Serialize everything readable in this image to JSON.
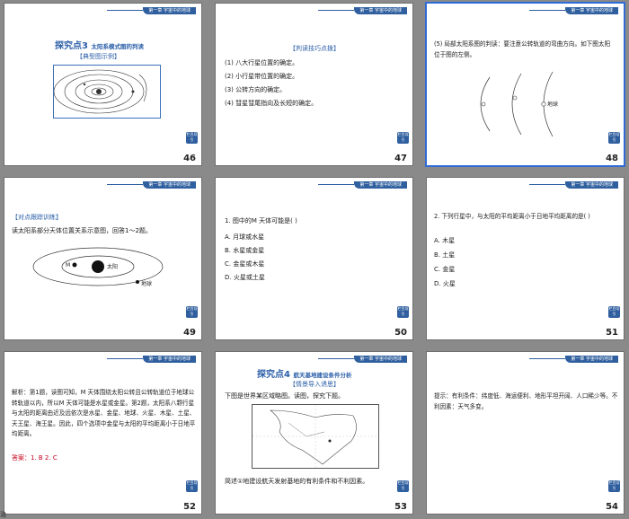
{
  "header_label": "第一章  宇宙中的地球",
  "return_label": "栏目导引",
  "status_text": "治",
  "slides": [
    {
      "num": "46",
      "topic_num": "探究点3",
      "topic_title": "太阳系模式图的判读",
      "sub_label": "【典型图示例】"
    },
    {
      "num": "47",
      "tip_title": "【判读技巧点拨】",
      "lines": [
        "(1) 八大行星位置的确定。",
        "(2) 小行星带位置的确定。",
        "(3) 公转方向的确定。",
        "(4) 彗星彗尾指向及长短的确定。"
      ]
    },
    {
      "num": "48",
      "text": "(5) 局部太阳系图的判读：要注意公转轨道的弯曲方向。如下图太阳位于图的左侧。",
      "earth_label": "地球"
    },
    {
      "num": "49",
      "train_label": "【对点跟踪训练】",
      "text": "读太阳系部分天体位置关系示意图，回答1～2题。",
      "m_label": "M",
      "sun_label": "太阳",
      "earth_label": "地球"
    },
    {
      "num": "50",
      "question": "1. 图中的M 天体可能是(      )",
      "options": [
        "A. 月球或水星",
        "B. 水星或金星",
        "C. 金星或木星",
        "D. 火星或土星"
      ]
    },
    {
      "num": "51",
      "question": "2. 下列行星中，与太阳的平均距离小于日地平均距离的是(      )",
      "options": [
        "A. 木星",
        "B. 土星",
        "C. 金星",
        "D. 火星"
      ]
    },
    {
      "num": "52",
      "explain": "解析：第1题，读图可知，M 天体围绕太阳公转且公转轨道位于地球公转轨道以内，所以M 天体可能是水星或金星。第2题，太阳系八颗行星与太阳的距离由近及远依次是水星、金星、地球、火星、木星、土星、天王星、海王星。因此，四个选项中金星与太阳的平均距离小于日地平均距离。",
      "answer": "答案：1. B   2. C"
    },
    {
      "num": "53",
      "topic_num": "探究点4",
      "topic_title": "航天基地建设条件分析",
      "sub_label": "【情景导入诱思】",
      "text1": "下图是世界某区域略图。读图，探究下题。",
      "text2": "简述①地建设航天发射基地的有利条件和不利因素。"
    },
    {
      "num": "54",
      "hint": "提示：有利条件：纬度低、海运便利、地形平坦开阔、人口稀少等。不利因素：天气多变。"
    }
  ]
}
